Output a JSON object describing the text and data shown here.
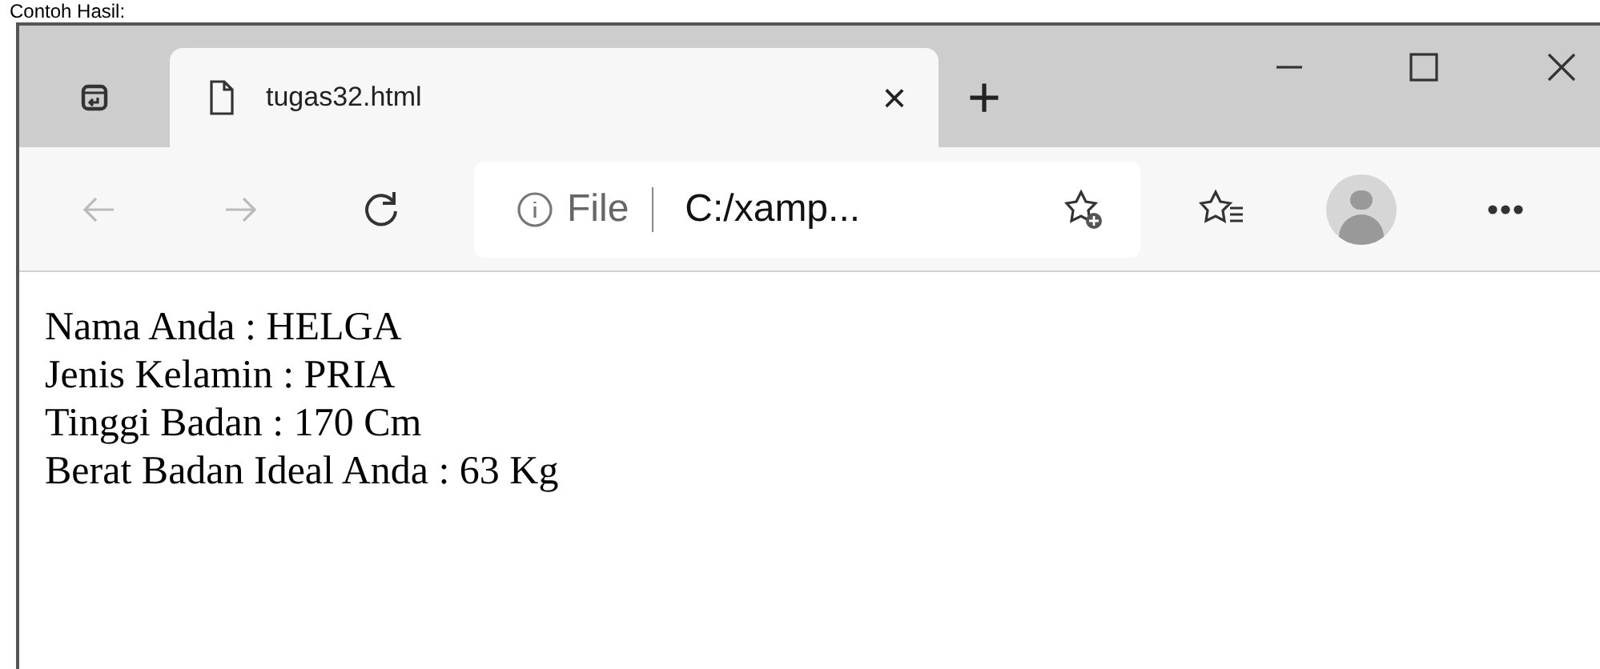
{
  "caption": "Contoh Hasil:",
  "tabs": [
    {
      "title": "tugas32.html",
      "selected": true,
      "close": "×"
    }
  ],
  "new_tab": "+",
  "address_bar": {
    "scheme": "File",
    "url": "C:/xamp..."
  },
  "content": {
    "lines": [
      "Nama Anda : HELGA",
      "Jenis Kelamin : PRIA",
      "Tinggi Badan : 170 Cm",
      "Berat Badan Ideal Anda : 63 Kg"
    ]
  }
}
